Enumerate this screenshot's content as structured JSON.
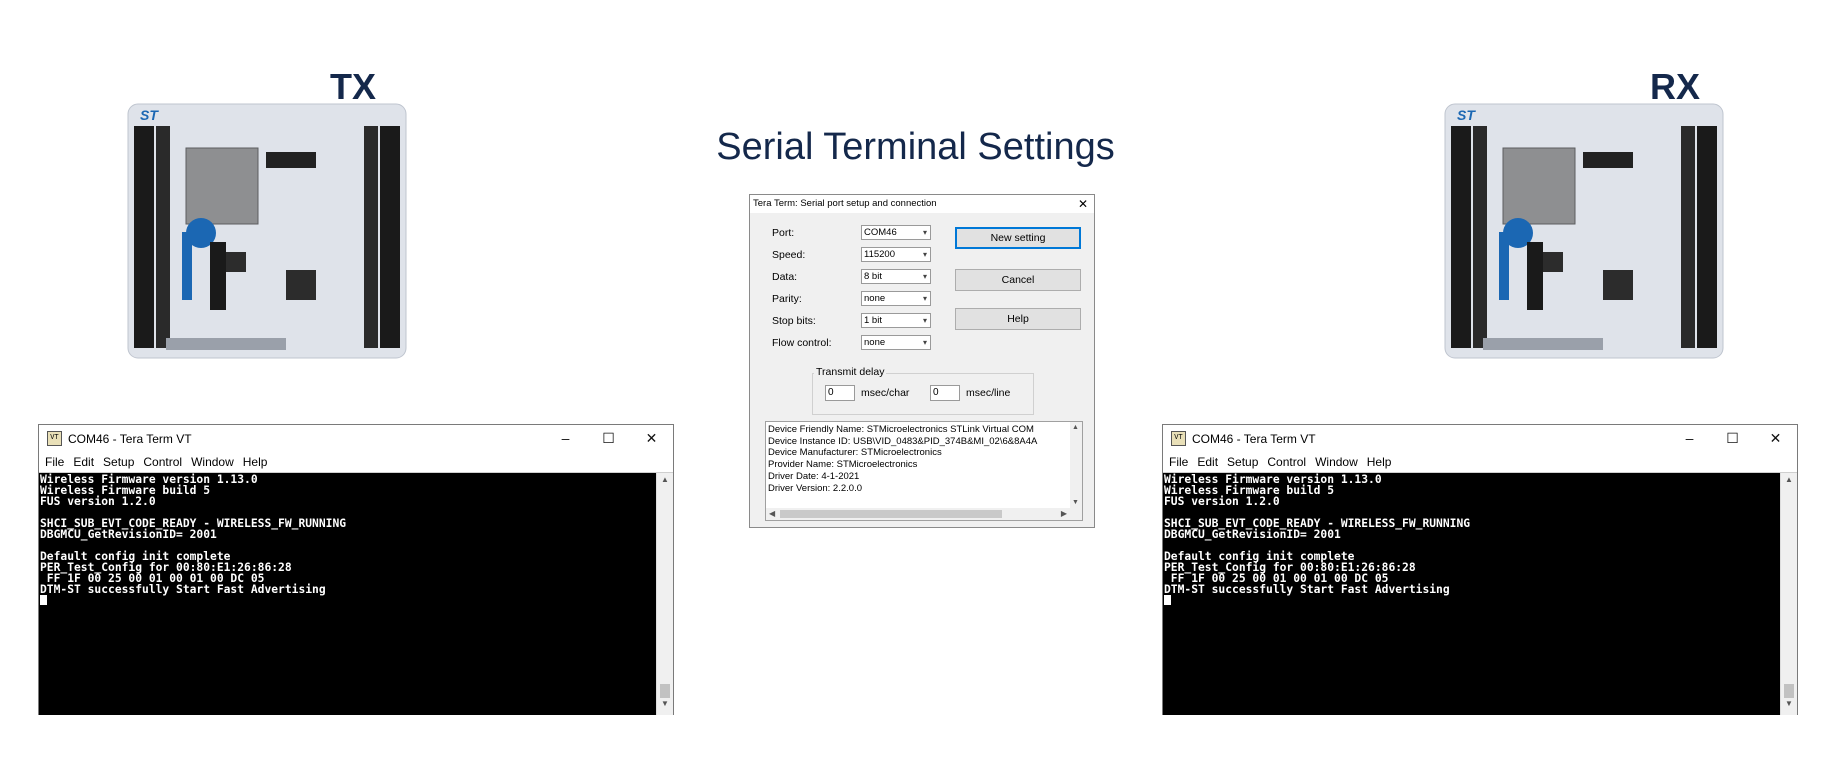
{
  "labels": {
    "tx": "TX",
    "rx": "RX"
  },
  "title": "Serial Terminal Settings",
  "terminal": {
    "title": "COM46 - Tera Term VT",
    "app_icon": "VT",
    "menu": [
      "File",
      "Edit",
      "Setup",
      "Control",
      "Window",
      "Help"
    ],
    "lines": [
      "Wireless Firmware version 1.13.0",
      "Wireless Firmware build 5",
      "FUS version 1.2.0",
      "",
      "SHCI_SUB_EVT_CODE_READY - WIRELESS_FW_RUNNING",
      "DBGMCU_GetRevisionID= 2001",
      "",
      "Default config init complete",
      "PER_Test_Config for 00:80:E1:26:86:28",
      " FF 1F 00 25 00 01 00 01 00 DC 05",
      "DTM-ST successfully Start Fast Advertising"
    ],
    "window_buttons": {
      "minimize": "–",
      "maximize": "☐",
      "close": "✕"
    }
  },
  "dialog": {
    "title": "Tera Term: Serial port setup and connection",
    "close": "✕",
    "fields": [
      {
        "label": "Port:",
        "value": "COM46"
      },
      {
        "label": "Speed:",
        "value": "115200"
      },
      {
        "label": "Data:",
        "value": "8 bit"
      },
      {
        "label": "Parity:",
        "value": "none"
      },
      {
        "label": "Stop bits:",
        "value": "1 bit"
      },
      {
        "label": "Flow control:",
        "value": "none"
      }
    ],
    "buttons": {
      "new_setting": "New setting",
      "cancel": "Cancel",
      "help": "Help"
    },
    "transmit_delay": {
      "label": "Transmit delay",
      "char_value": "0",
      "char_unit": "msec/char",
      "line_value": "0",
      "line_unit": "msec/line"
    },
    "info_lines": [
      "Device Friendly Name: STMicroelectronics STLink Virtual COM",
      "Device Instance ID: USB\\VID_0483&PID_374B&MI_02\\6&8A4A",
      "Device Manufacturer: STMicroelectronics",
      "Provider Name: STMicroelectronics",
      "Driver Date: 4-1-2021",
      "Driver Version: 2.2.0.0"
    ]
  }
}
